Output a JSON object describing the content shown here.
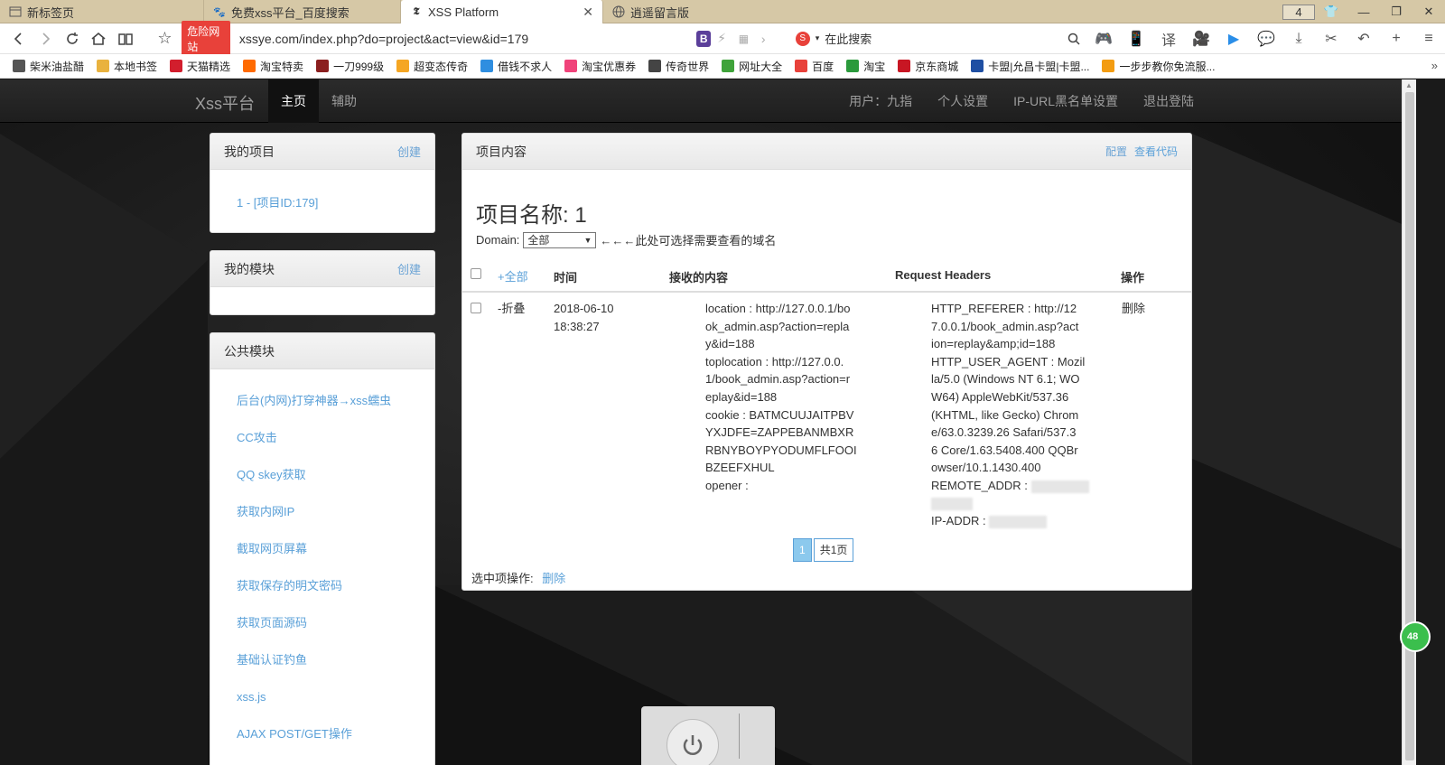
{
  "browser": {
    "tabs": [
      {
        "label": "新标签页",
        "icon": "new-tab-icon"
      },
      {
        "label": "免费xss平台_百度搜索",
        "icon": "baidu-paw-icon"
      },
      {
        "label": "XSS Platform",
        "icon": "xss-platform-icon",
        "active": true
      },
      {
        "label": "逍遥留言版",
        "icon": "globe-icon"
      }
    ],
    "tab_count": "4",
    "danger_badge": "危险网站",
    "url": "xssye.com/index.php?do=project&act=view&id=179",
    "search_placeholder": "在此搜索",
    "bookmarks": [
      {
        "label": "柴米油盐醋",
        "color": "#555"
      },
      {
        "label": "本地书签",
        "color": "#e9b23e"
      },
      {
        "label": "天猫精选",
        "color": "#d21e2d"
      },
      {
        "label": "淘宝特卖",
        "color": "#ff6a00"
      },
      {
        "label": "一刀999级",
        "color": "#8b1f1f"
      },
      {
        "label": "超变态传奇",
        "color": "#f5a623"
      },
      {
        "label": "借钱不求人",
        "color": "#2f8ee0"
      },
      {
        "label": "淘宝优惠券",
        "color": "#f0437a"
      },
      {
        "label": "传奇世界",
        "color": "#444"
      },
      {
        "label": "网址大全",
        "color": "#3fa33a"
      },
      {
        "label": "百度",
        "color": "#e8413a"
      },
      {
        "label": "淘宝",
        "color": "#2b9a3c"
      },
      {
        "label": "京东商城",
        "color": "#c81623"
      },
      {
        "label": "卡盟|允昌卡盟|卡盟...",
        "color": "#1f4fa3"
      },
      {
        "label": "一步步教你免流服...",
        "color": "#f39c12"
      }
    ]
  },
  "app": {
    "brand": "Xss平台",
    "nav": [
      "主页",
      "辅助"
    ],
    "user_label": "用户：九指",
    "right_links": [
      "个人设置",
      "IP-URL黑名单设置",
      "退出登陆"
    ]
  },
  "sidebar": {
    "my_projects": {
      "title": "我的项目",
      "action": "创建",
      "items": [
        "1 - [项目ID:179]"
      ]
    },
    "my_modules": {
      "title": "我的模块",
      "action": "创建"
    },
    "public_modules": {
      "title": "公共模块",
      "items": [
        "后台(内网)打穿神器→xss蠕虫",
        "CC攻击",
        "QQ skey获取",
        "获取内网IP",
        "截取网页屏幕",
        "获取保存的明文密码",
        "获取页面源码",
        "基础认证钓鱼",
        "xss.js",
        "AJAX POST/GET操作"
      ]
    }
  },
  "content": {
    "panel_title": "项目内容",
    "config_link": "配置",
    "view_code_link": "查看代码",
    "project_name": "项目名称: 1",
    "domain_label": "Domain:",
    "domain_selected": "全部",
    "domain_hint": "←←←此处可选择需要查看的域名",
    "columns": {
      "expand": "+全部",
      "time": "时间",
      "received": "接收的内容",
      "headers": "Request Headers",
      "ops": "操作"
    },
    "rows": [
      {
        "toggle": "-折叠",
        "date": "2018-06-10",
        "time": "18:38:27",
        "received": [
          "location : http://127.0.0.1/bo",
          "ok_admin.asp?action=repla",
          "y&id=188",
          "toplocation : http://127.0.0.",
          "1/book_admin.asp?action=r",
          "eplay&id=188",
          "cookie : BATMCUUJAITPBV",
          "YXJDFE=ZAPPEBANMBXR",
          "RBNYBOYPYODUMFLFOOI",
          "BZEEFXHUL",
          "opener :"
        ],
        "headers": [
          "HTTP_REFERER : http://12",
          "7.0.0.1/book_admin.asp?act",
          "ion=replay&amp;id=188",
          "HTTP_USER_AGENT : Mozil",
          "la/5.0 (Windows NT 6.1; WO",
          "W64) AppleWebKit/537.36",
          "(KHTML, like Gecko) Chrom",
          "e/63.0.3239.26 Safari/537.3",
          "6 Core/1.63.5408.400 QQBr",
          "owser/10.1.1430.400"
        ],
        "remote_addr_label": "REMOTE_ADDR :",
        "ip_addr_label": "IP-ADDR :",
        "delete": "删除"
      }
    ],
    "pager": {
      "current": "1",
      "total": "共1页"
    },
    "selected_ops_label": "选中项操作:",
    "selected_delete": "删除"
  },
  "float_badge": "48",
  "colors": {
    "link": "#5aa0d8",
    "danger": "#e8413a",
    "nav_bg": "#222222"
  }
}
